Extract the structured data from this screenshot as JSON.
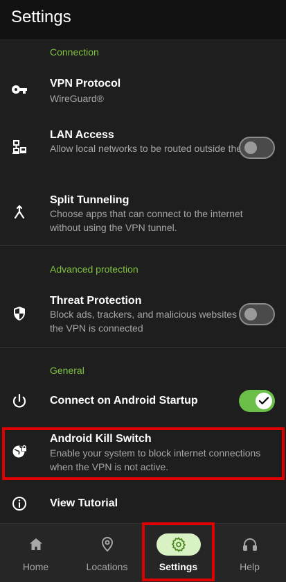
{
  "header": {
    "title": "Settings"
  },
  "sections": {
    "connection": "Connection",
    "advanced": "Advanced protection",
    "general": "General"
  },
  "rows": {
    "vpn_protocol": {
      "label": "VPN Protocol",
      "sub": "WireGuard®",
      "icon": "key-icon"
    },
    "lan_access": {
      "label": "LAN Access",
      "sub": "Allow local networks to be routed outside the VPN.",
      "icon": "lan-icon",
      "toggle": false
    },
    "split_tunneling": {
      "label": "Split Tunneling",
      "sub": "Choose apps that can connect to the internet without using the VPN tunnel.",
      "icon": "split-arrow-icon"
    },
    "threat_protection": {
      "label": "Threat Protection",
      "sub": "Block ads, trackers, and malicious websites when the VPN is connected",
      "icon": "shield-icon",
      "toggle": false
    },
    "connect_startup": {
      "label": "Connect on Android Startup",
      "icon": "power-icon",
      "toggle": true
    },
    "kill_switch": {
      "label": "Android Kill Switch",
      "sub": "Enable your system to block internet connections when the VPN is not active.",
      "icon": "globe-lock-icon"
    },
    "tutorial": {
      "label": "View Tutorial",
      "icon": "info-icon"
    }
  },
  "nav": [
    {
      "label": "Home",
      "icon": "home-icon",
      "active": false
    },
    {
      "label": "Locations",
      "icon": "location-pin-icon",
      "active": false
    },
    {
      "label": "Settings",
      "icon": "gear-icon",
      "active": true
    },
    {
      "label": "Help",
      "icon": "headset-icon",
      "active": false
    }
  ],
  "colors": {
    "accent": "#7fc241",
    "toggle_on": "#6cc04a",
    "highlight": "#e00000",
    "nav_active_bg": "#d9f2c4"
  }
}
